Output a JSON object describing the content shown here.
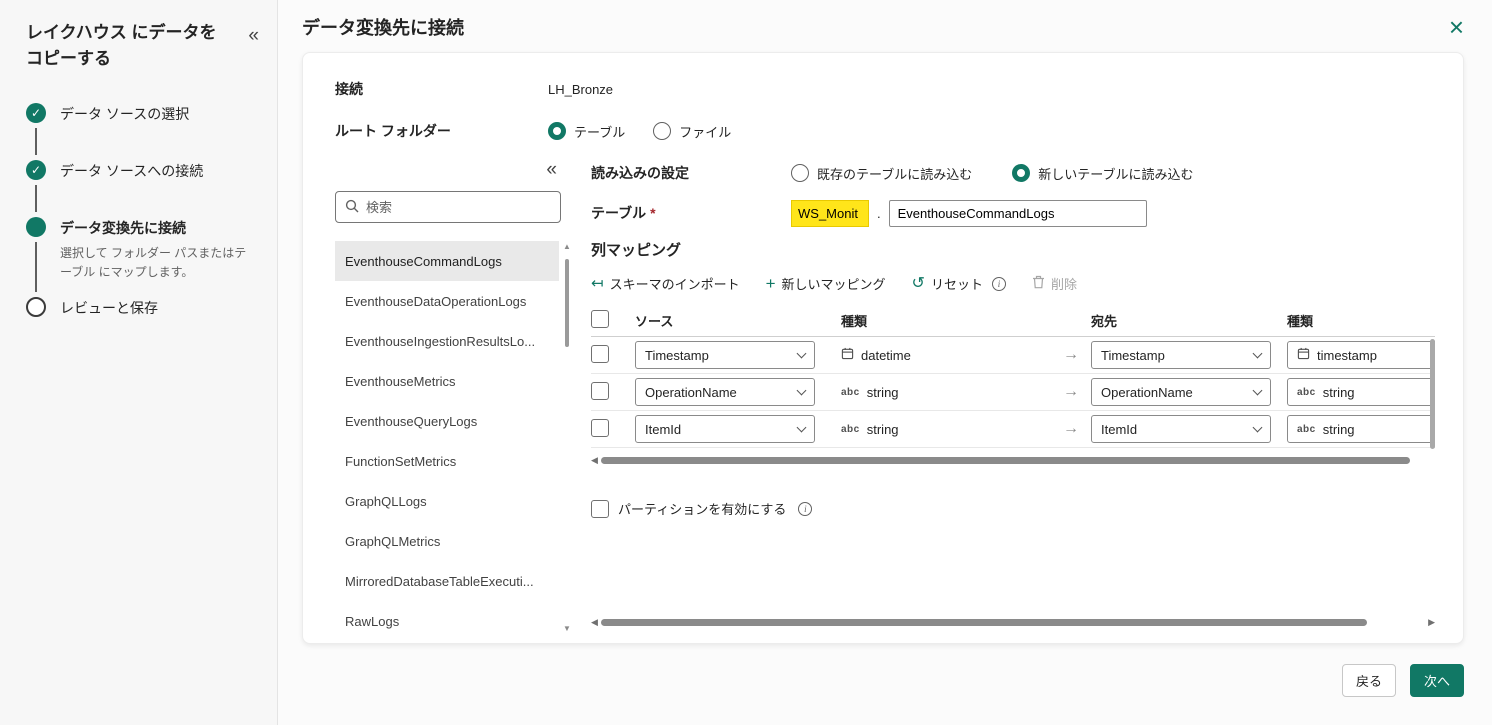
{
  "colors": {
    "accent": "#117865",
    "highlight": "#ffe51a"
  },
  "icons": {
    "collapse": "«",
    "close": "×",
    "check": "✓",
    "arrow": "→",
    "import": "↤",
    "add": "+",
    "reset": "↺",
    "info": "i",
    "abc": "abc",
    "up": "▲",
    "down": "▼",
    "left": "◀",
    "right": "▶"
  },
  "sidebar": {
    "title": "レイクハウス にデータをコピーする",
    "steps": [
      {
        "label": "データ ソースの選択"
      },
      {
        "label": "データ ソースへの接続"
      },
      {
        "label": "データ変換先に接続",
        "description": "選択して フォルダー パスまたはテーブル にマップします。"
      },
      {
        "label": "レビューと保存"
      }
    ]
  },
  "header": {
    "title": "データ変換先に接続"
  },
  "form": {
    "connection_label": "接続",
    "connection_value": "LH_Bronze",
    "root_folder_label": "ルート フォルダー",
    "root_options": [
      {
        "label": "テーブル"
      },
      {
        "label": "ファイル"
      }
    ]
  },
  "explorer": {
    "search_placeholder": "検索",
    "items": [
      "EventhouseCommandLogs",
      "EventhouseDataOperationLogs",
      "EventhouseIngestionResultsLo...",
      "EventhouseMetrics",
      "EventhouseQueryLogs",
      "FunctionSetMetrics",
      "GraphQLLogs",
      "GraphQLMetrics",
      "MirroredDatabaseTableExecuti...",
      "RawLogs"
    ]
  },
  "load": {
    "label": "読み込みの設定",
    "options": [
      {
        "label": "既存のテーブルに読み込む"
      },
      {
        "label": "新しいテーブルに読み込む"
      }
    ]
  },
  "table_field": {
    "label": "テーブル",
    "required": "*",
    "schema_value": "WS_Monit",
    "separator": ".",
    "name_value": "EventhouseCommandLogs"
  },
  "mapping": {
    "title": "列マッピング",
    "toolbar": {
      "import": "スキーマのインポート",
      "add": "新しいマッピング",
      "reset": "リセット",
      "delete": "削除"
    },
    "columns": {
      "source": "ソース",
      "source_type": "種類",
      "dest": "宛先",
      "dest_type": "種類"
    },
    "rows": [
      {
        "source": "Timestamp",
        "source_type": "datetime",
        "dest": "Timestamp",
        "dest_type": "timestamp",
        "icon": "calendar-icon"
      },
      {
        "source": "OperationName",
        "source_type": "string",
        "dest": "OperationName",
        "dest_type": "string",
        "icon": "abc-icon"
      },
      {
        "source": "ItemId",
        "source_type": "string",
        "dest": "ItemId",
        "dest_type": "string",
        "icon": "abc-icon"
      }
    ],
    "partition_label": "パーティションを有効にする"
  },
  "footer": {
    "back": "戻る",
    "next": "次へ"
  }
}
